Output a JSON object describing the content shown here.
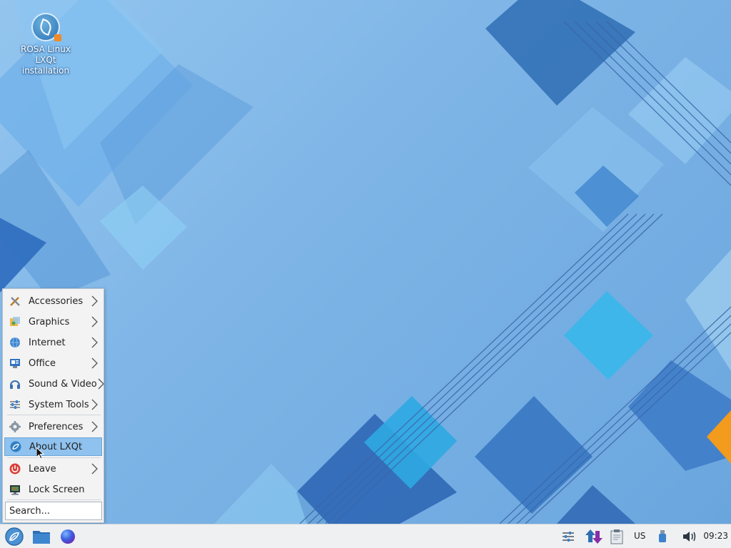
{
  "desktop": {
    "icon": {
      "label_lines": [
        "ROSA Linux",
        "LXQt",
        "installation"
      ]
    }
  },
  "menu": {
    "items": [
      {
        "label": "Accessories",
        "icon": "accessories-icon",
        "submenu": true
      },
      {
        "label": "Graphics",
        "icon": "graphics-icon",
        "submenu": true
      },
      {
        "label": "Internet",
        "icon": "internet-icon",
        "submenu": true
      },
      {
        "label": "Office",
        "icon": "office-icon",
        "submenu": true
      },
      {
        "label": "Sound & Video",
        "icon": "sound-video-icon",
        "submenu": true
      },
      {
        "label": "System Tools",
        "icon": "system-tools-icon",
        "submenu": true
      },
      {
        "label": "Preferences",
        "icon": "preferences-icon",
        "submenu": true
      },
      {
        "label": "About LXQt",
        "icon": "about-lxqt-icon",
        "submenu": false,
        "highlighted": true
      },
      {
        "label": "Leave",
        "icon": "leave-icon",
        "submenu": true
      },
      {
        "label": "Lock Screen",
        "icon": "lock-screen-icon",
        "submenu": false
      }
    ],
    "search": {
      "placeholder": "Search..."
    }
  },
  "taskbar": {
    "launchers": [
      "start-menu-icon",
      "file-manager-icon",
      "browser-icon"
    ],
    "tray": [
      "panel-settings-icon",
      "network-transfer-icon",
      "clipboard-icon",
      "usb-icon",
      "volume-icon"
    ],
    "keyboard_layout": "US",
    "clock": "09:23"
  },
  "colors": {
    "highlight": "#8fc2ee",
    "wallpaper_base": "#7db4e6",
    "accent_orange": "#f08a2a"
  }
}
